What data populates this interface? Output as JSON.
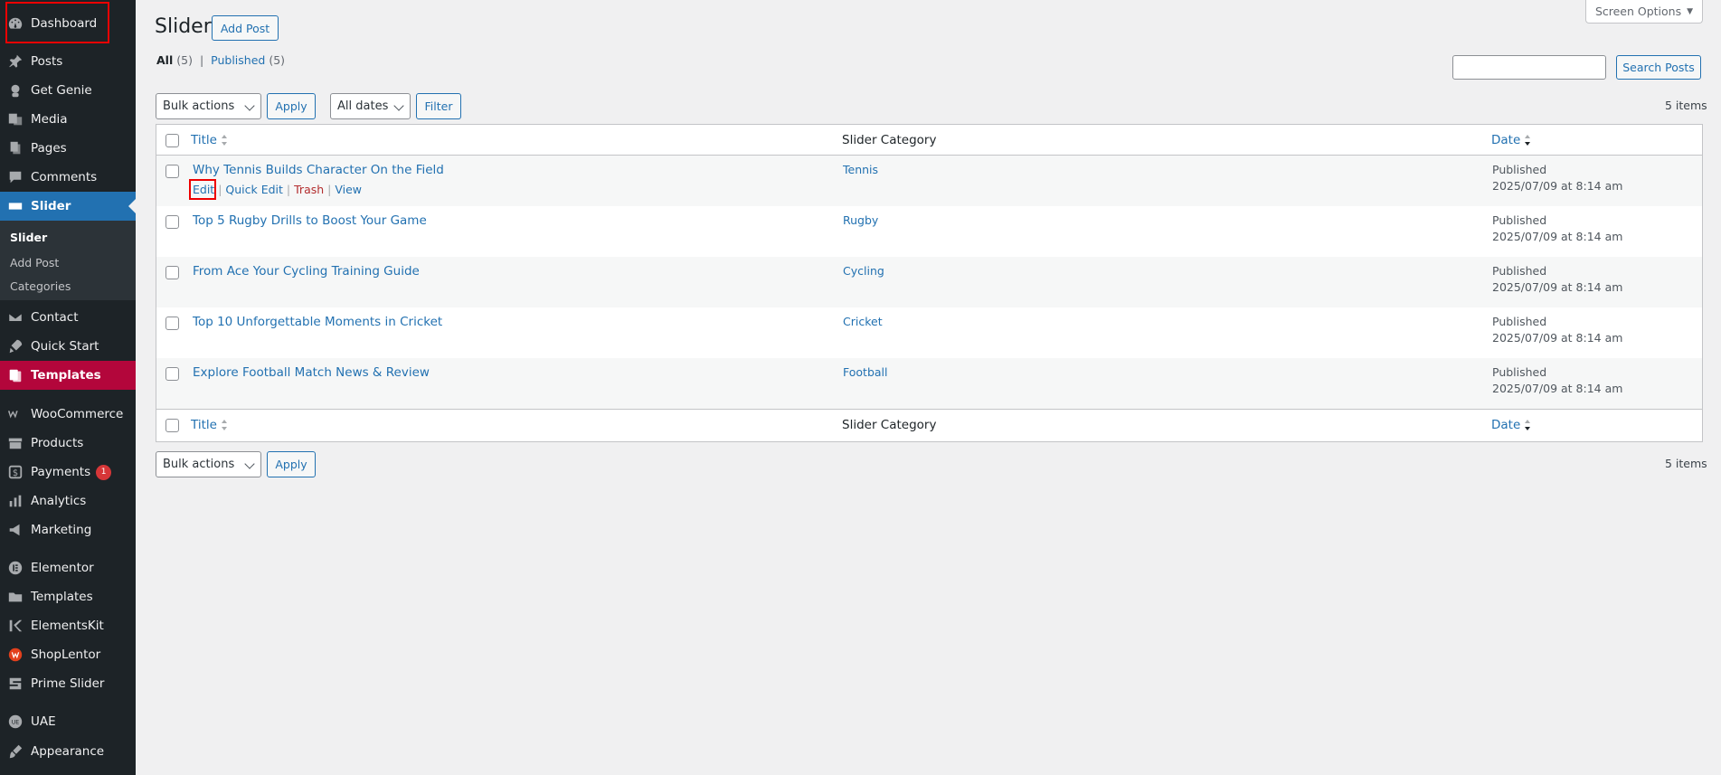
{
  "sidebar": {
    "items": [
      {
        "label": "Dashboard"
      },
      {
        "label": "Posts"
      },
      {
        "label": "Get Genie"
      },
      {
        "label": "Media"
      },
      {
        "label": "Pages"
      },
      {
        "label": "Comments"
      },
      {
        "label": "Slider"
      },
      {
        "label": "Contact"
      },
      {
        "label": "Quick Start"
      },
      {
        "label": "Templates"
      },
      {
        "label": "WooCommerce"
      },
      {
        "label": "Products"
      },
      {
        "label": "Payments",
        "badge": "1"
      },
      {
        "label": "Analytics"
      },
      {
        "label": "Marketing"
      },
      {
        "label": "Elementor"
      },
      {
        "label": "Templates"
      },
      {
        "label": "ElementsKit"
      },
      {
        "label": "ShopLentor"
      },
      {
        "label": "Prime Slider"
      },
      {
        "label": "UAE"
      },
      {
        "label": "Appearance"
      }
    ],
    "submenu": [
      "Slider",
      "Add Post",
      "Categories"
    ]
  },
  "header": {
    "title": "Slider",
    "add_post": "Add Post",
    "screen_options": "Screen Options"
  },
  "filters": {
    "all_label": "All",
    "all_count": "(5)",
    "sep": "|",
    "published_label": "Published",
    "published_count": "(5)",
    "search_button": "Search Posts",
    "bulk_actions": "Bulk actions",
    "apply": "Apply",
    "all_dates": "All dates",
    "filter": "Filter",
    "items_count": "5 items"
  },
  "table": {
    "col_title": "Title",
    "col_category": "Slider Category",
    "col_date": "Date",
    "row_actions": {
      "edit": "Edit",
      "quick_edit": "Quick Edit",
      "trash": "Trash",
      "view": "View",
      "sep": "|"
    },
    "rows": [
      {
        "title": "Why Tennis Builds Character On the Field",
        "category": "Tennis",
        "status": "Published",
        "date": "2025/07/09 at 8:14 am"
      },
      {
        "title": "Top 5 Rugby Drills to Boost Your Game",
        "category": "Rugby",
        "status": "Published",
        "date": "2025/07/09 at 8:14 am"
      },
      {
        "title": "From Ace Your Cycling Training Guide",
        "category": "Cycling",
        "status": "Published",
        "date": "2025/07/09 at 8:14 am"
      },
      {
        "title": "Top 10 Unforgettable Moments in Cricket",
        "category": "Cricket",
        "status": "Published",
        "date": "2025/07/09 at 8:14 am"
      },
      {
        "title": "Explore Football Match News & Review",
        "category": "Football",
        "status": "Published",
        "date": "2025/07/09 at 8:14 am"
      }
    ]
  },
  "colors": {
    "admin_bg": "#1d2327",
    "accent": "#2271b1",
    "highlight": "#b3063b"
  }
}
